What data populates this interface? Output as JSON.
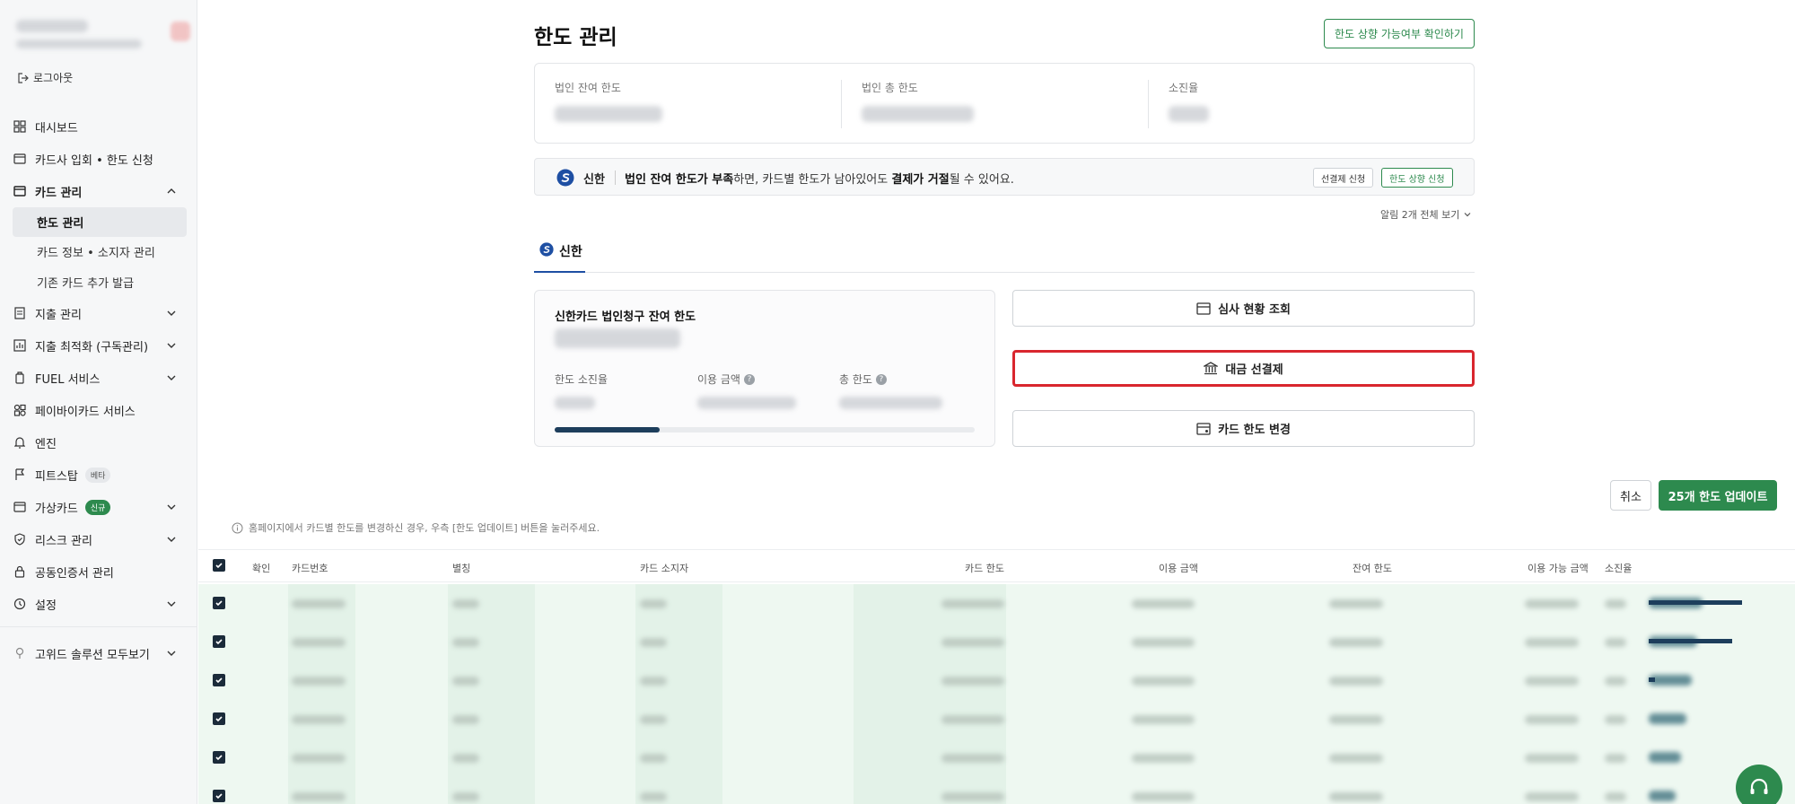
{
  "sidebar": {
    "logout_label": "로그아웃",
    "items": [
      {
        "label": "대시보드"
      },
      {
        "label": "카드사 입회 • 한도 신청"
      },
      {
        "label": "카드 관리"
      },
      {
        "label": "지출 관리"
      },
      {
        "label": "지출 최적화 (구독관리)"
      },
      {
        "label": "FUEL 서비스"
      },
      {
        "label": "페이바이카드 서비스"
      },
      {
        "label": "엔진"
      },
      {
        "label": "피트스탑",
        "badge": "베타"
      },
      {
        "label": "가상카드",
        "badge": "신규"
      },
      {
        "label": "리스크 관리"
      },
      {
        "label": "공동인증서 관리"
      },
      {
        "label": "설정"
      },
      {
        "label": "고위드 솔루션 모두보기"
      }
    ],
    "sub_items": [
      {
        "label": "한도 관리"
      },
      {
        "label": "카드 정보 • 소지자 관리"
      },
      {
        "label": "기존 카드 추가 발급"
      }
    ]
  },
  "main": {
    "title": "한도 관리",
    "check_button": "한도 상향 가능여부 확인하기",
    "summary": {
      "remaining_label": "법인 잔여 한도",
      "total_label": "법인 총 한도",
      "exhaustion_label": "소진율"
    },
    "notice": {
      "bank": "신한",
      "text_b1": "법인 잔여 한도가 부족",
      "text_1": "하면, 카드별 한도가 남아있어도 ",
      "text_b2": "결제가 거절",
      "text_2": "될 수 있어요.",
      "btn_prepay": "선결제 신청",
      "btn_increase": "한도 상향 신청"
    },
    "see_all": "알림 2개 전체 보기",
    "tab_label": "신한",
    "card": {
      "title": "신한카드 법인청구 잔여 한도",
      "exhaustion_label": "한도 소진율",
      "used_label": "이용 금액",
      "total_label": "총 한도",
      "progress_fraction": 0.25
    },
    "actions": {
      "review": "심사 현황 조회",
      "prepay": "대금 선결제",
      "change": "카드 한도 변경"
    },
    "cancel": "취소",
    "update": "25개 한도 업데이트",
    "hint": "홈페이지에서 카드별 한도를 변경하신 경우, 우측 [한도 업데이트] 버튼을 눌러주세요."
  },
  "table": {
    "headers": {
      "confirm": "확인",
      "card_no": "카드번호",
      "alias": "별칭",
      "holder": "카드 소지자",
      "limit": "카드 한도",
      "used": "이용 금액",
      "remaining": "잔여 한도",
      "available": "이용 가능 금액",
      "exhaustion": "소진율"
    },
    "bar_fractions": [
      0.7,
      0.63,
      0.05,
      0.0,
      0.0,
      0.0
    ]
  },
  "colors": {
    "brand_green": "#2d8a4e",
    "highlight_red": "#d9262e",
    "progress_navy": "#1d3e5c"
  }
}
